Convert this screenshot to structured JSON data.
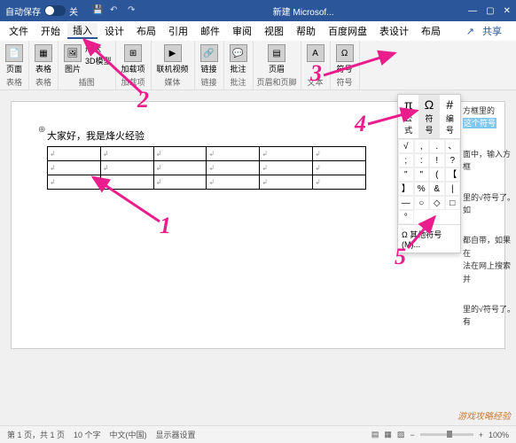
{
  "titlebar": {
    "autosave": "自动保存",
    "off": "关",
    "title": "新建 Microsof..."
  },
  "menu": {
    "file": "文件",
    "home": "开始",
    "insert": "插入",
    "design": "设计",
    "layout": "布局",
    "references": "引用",
    "mail": "邮件",
    "review": "审阅",
    "view": "视图",
    "help": "帮助",
    "baidu": "百度网盘",
    "tdesign": "表设计",
    "tlayout": "布局",
    "share": "共享"
  },
  "ribbon": {
    "pages": {
      "cover": "页面",
      "label": "表格"
    },
    "tables": {
      "table": "表格"
    },
    "illus": {
      "pic": "图片",
      "shapes": "形状",
      "model": "3D模型",
      "label": "插图"
    },
    "addins": {
      "addins": "加载项",
      "label": "加载项"
    },
    "media": {
      "video": "联机视频",
      "label": "媒体"
    },
    "links": {
      "link": "链接",
      "label": "链接"
    },
    "comments": {
      "comment": "批注",
      "label": "批注"
    },
    "header": {
      "header": "页眉",
      "label": "页眉和页脚"
    },
    "text": {
      "text": "A",
      "label": "文本"
    },
    "symbols": {
      "symbol": "符号",
      "label": "符号"
    }
  },
  "doc": {
    "greeting": "大家好，我是烽火经验"
  },
  "symbolPanel": {
    "eq": "公式",
    "sym": "符号",
    "num": "编号",
    "grid": [
      "√",
      ",",
      ".",
      "、",
      ";",
      ":",
      "!",
      "?",
      "\"",
      "\"",
      "(",
      "【",
      "】",
      "%",
      "&",
      "|",
      "—",
      "○",
      "◇",
      "□",
      "°"
    ],
    "more": "其他符号(M)..."
  },
  "hints": {
    "h1": "方框里的",
    "h2": "这个符号",
    "h3": "面中，输入方框",
    "h4": "里的√符号了。如",
    "h5": "都自带，如果在",
    "h6": "法在网上搜索并",
    "h7": "里的√符号了。有"
  },
  "status": {
    "page": "第 1 页，共 1 页",
    "words": "10 个字",
    "lang": "中文(中国)",
    "display": "显示器设置",
    "zoom": "100%"
  },
  "nums": {
    "n1": "1",
    "n2": "2",
    "n3": "3",
    "n4": "4",
    "n5": "5"
  },
  "watermark": "游戏攻略经验",
  "omega": "Ω",
  "pi": "π",
  "hash": "#"
}
